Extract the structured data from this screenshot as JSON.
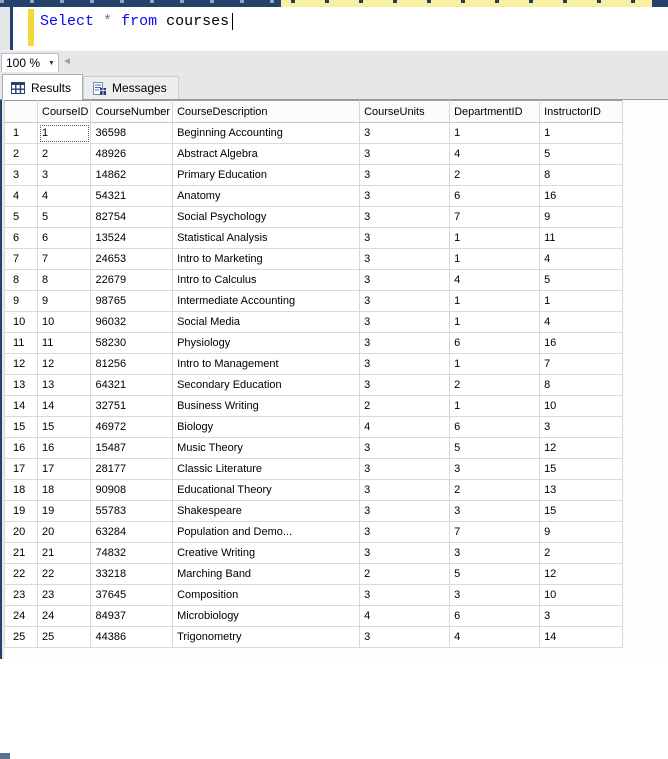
{
  "colors": {
    "navy": "#24416b",
    "tab_yellow": "#faf0a2",
    "change_bar_yellow": "#f2d83a",
    "keyword_blue": "#0909f5"
  },
  "editor": {
    "code_tokens": [
      {
        "text": "Select",
        "style": "keyword"
      },
      {
        "text": " ",
        "style": "plain"
      },
      {
        "text": "*",
        "style": "operator"
      },
      {
        "text": " ",
        "style": "plain"
      },
      {
        "text": "from",
        "style": "keyword"
      },
      {
        "text": " ",
        "style": "plain"
      },
      {
        "text": "courses",
        "style": "plain"
      }
    ]
  },
  "zoom_control": {
    "value": "100 %",
    "dropdown_icon": "▼"
  },
  "scrollbar": {
    "left_arrow_icon": "◄"
  },
  "result_tabs": [
    {
      "label": "Results",
      "icon": "results-grid-icon",
      "active": true
    },
    {
      "label": "Messages",
      "icon": "messages-icon",
      "active": false
    }
  ],
  "grid": {
    "columns": [
      "CourseID",
      "CourseNumber",
      "CourseDescription",
      "CourseUnits",
      "DepartmentID",
      "InstructorID"
    ],
    "rows": [
      [
        "1",
        "1",
        "36598",
        "Beginning Accounting",
        "3",
        "1",
        "1"
      ],
      [
        "2",
        "2",
        "48926",
        "Abstract Algebra",
        "3",
        "4",
        "5"
      ],
      [
        "3",
        "3",
        "14862",
        "Primary Education",
        "3",
        "2",
        "8"
      ],
      [
        "4",
        "4",
        "54321",
        "Anatomy",
        "3",
        "6",
        "16"
      ],
      [
        "5",
        "5",
        "82754",
        "Social Psychology",
        "3",
        "7",
        "9"
      ],
      [
        "6",
        "6",
        "13524",
        "Statistical Analysis",
        "3",
        "1",
        "11"
      ],
      [
        "7",
        "7",
        "24653",
        "Intro to Marketing",
        "3",
        "1",
        "4"
      ],
      [
        "8",
        "8",
        "22679",
        "Intro to Calculus",
        "3",
        "4",
        "5"
      ],
      [
        "9",
        "9",
        "98765",
        "Intermediate Accounting",
        "3",
        "1",
        "1"
      ],
      [
        "10",
        "10",
        "96032",
        "Social Media",
        "3",
        "1",
        "4"
      ],
      [
        "11",
        "11",
        "58230",
        "Physiology",
        "3",
        "6",
        "16"
      ],
      [
        "12",
        "12",
        "81256",
        "Intro to Management",
        "3",
        "1",
        "7"
      ],
      [
        "13",
        "13",
        "64321",
        "Secondary Education",
        "3",
        "2",
        "8"
      ],
      [
        "14",
        "14",
        "32751",
        "Business Writing",
        "2",
        "1",
        "10"
      ],
      [
        "15",
        "15",
        "46972",
        "Biology",
        "4",
        "6",
        "3"
      ],
      [
        "16",
        "16",
        "15487",
        "Music Theory",
        "3",
        "5",
        "12"
      ],
      [
        "17",
        "17",
        "28177",
        "Classic Literature",
        "3",
        "3",
        "15"
      ],
      [
        "18",
        "18",
        "90908",
        "Educational Theory",
        "3",
        "2",
        "13"
      ],
      [
        "19",
        "19",
        "55783",
        "Shakespeare",
        "3",
        "3",
        "15"
      ],
      [
        "20",
        "20",
        "63284",
        "Population and Demo...",
        "3",
        "7",
        "9"
      ],
      [
        "21",
        "21",
        "74832",
        "Creative Writing",
        "3",
        "3",
        "2"
      ],
      [
        "22",
        "22",
        "33218",
        "Marching Band",
        "2",
        "5",
        "12"
      ],
      [
        "23",
        "23",
        "37645",
        "Composition",
        "3",
        "3",
        "10"
      ],
      [
        "24",
        "24",
        "84937",
        "Microbiology",
        "4",
        "6",
        "3"
      ],
      [
        "25",
        "25",
        "44386",
        "Trigonometry",
        "3",
        "4",
        "14"
      ]
    ],
    "selected_cell": {
      "row_index": 0,
      "col_index": 1
    }
  }
}
